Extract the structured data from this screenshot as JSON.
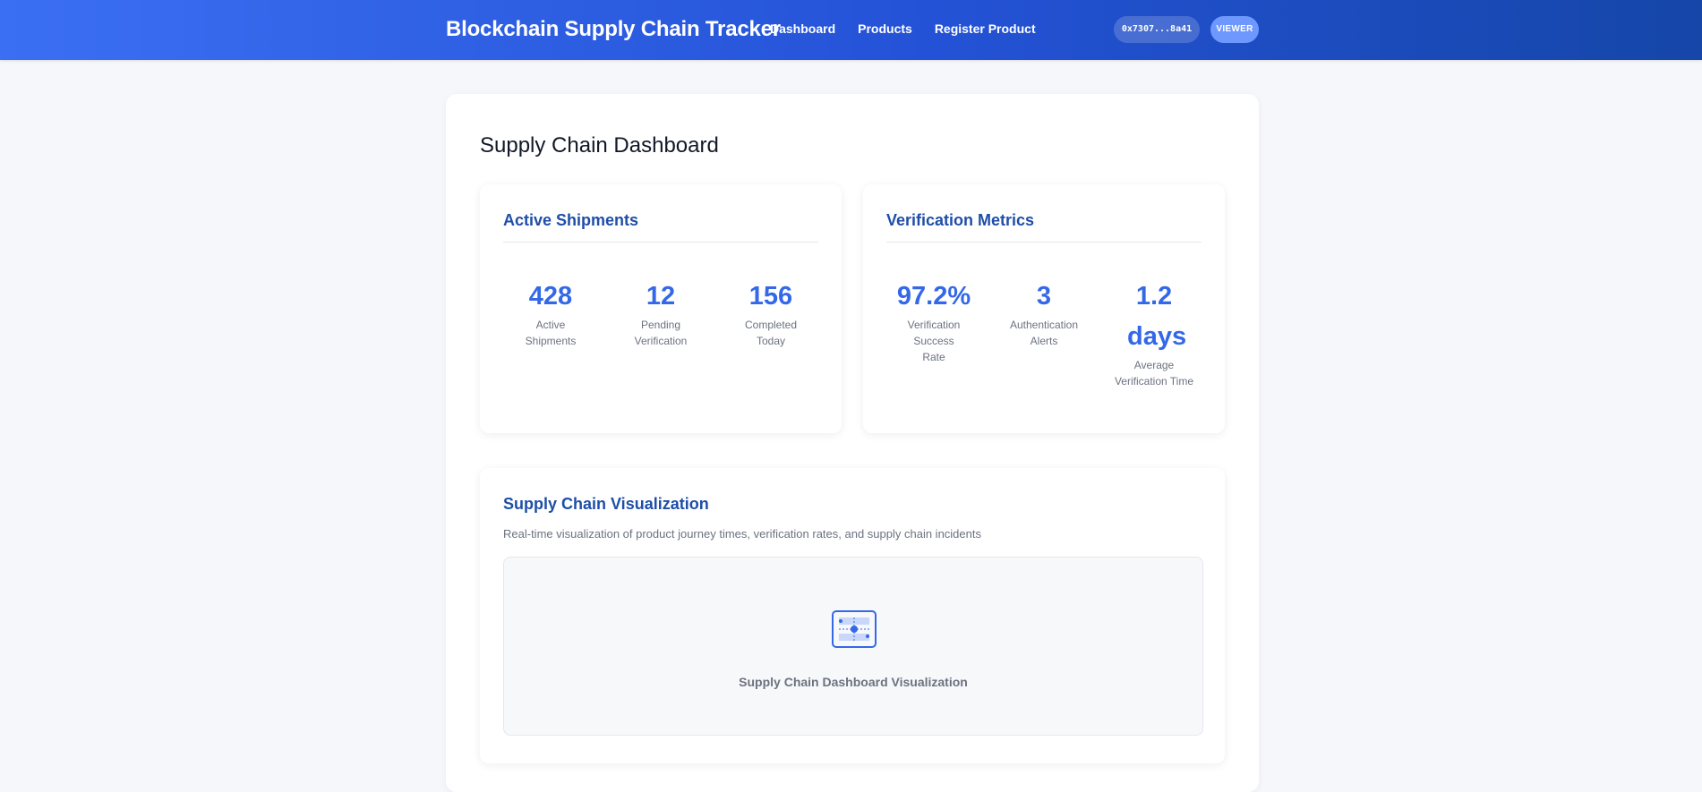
{
  "header": {
    "title": "Blockchain Supply Chain Tracker",
    "nav": [
      "Dashboard",
      "Products",
      "Register Product"
    ],
    "wallet": "0x7307...8a41",
    "role": "VIEWER"
  },
  "page": {
    "title": "Supply Chain Dashboard"
  },
  "shipments": {
    "title": "Active Shipments",
    "stats": [
      {
        "value": "428",
        "label": "Active Shipments"
      },
      {
        "value": "12",
        "label": "Pending Verification"
      },
      {
        "value": "156",
        "label": "Completed Today"
      }
    ]
  },
  "verification": {
    "title": "Verification Metrics",
    "stats": [
      {
        "value": "97.2%",
        "label": "Verification Success Rate"
      },
      {
        "value": "3",
        "label": "Authentication Alerts"
      },
      {
        "value": "1.2 days",
        "label": "Average Verification Time"
      }
    ]
  },
  "visualization": {
    "title": "Supply Chain Visualization",
    "description": "Real-time visualization of product journey times, verification rates, and supply chain incidents",
    "placeholder_icon": "chart-icon",
    "caption": "Supply Chain Dashboard Visualization"
  },
  "colors": {
    "accent": "#3468e8",
    "header_start": "#3b6ff3",
    "header_end": "#1546a8",
    "card_title": "#1e4ea8"
  }
}
